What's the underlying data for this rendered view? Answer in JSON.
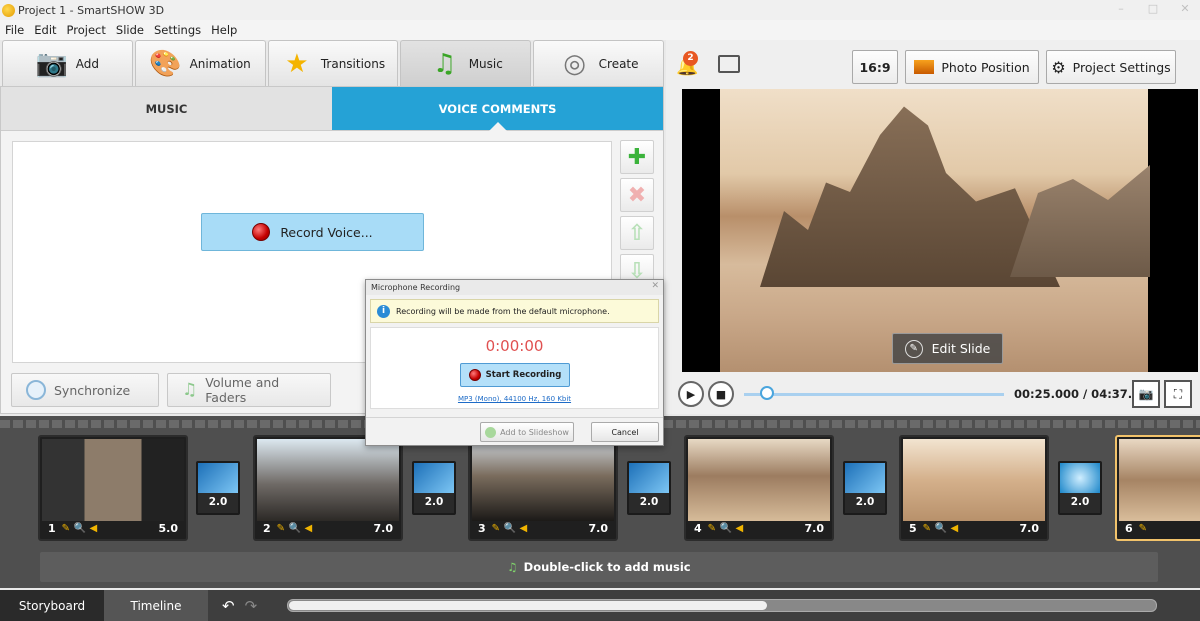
{
  "window": {
    "title": "Project 1 - SmartSHOW 3D"
  },
  "menu": [
    "File",
    "Edit",
    "Project",
    "Slide",
    "Settings",
    "Help"
  ],
  "tabs": [
    {
      "label": "Add",
      "icon": "camera-icon"
    },
    {
      "label": "Animation",
      "icon": "palette-icon"
    },
    {
      "label": "Transitions",
      "icon": "star-icon"
    },
    {
      "label": "Music",
      "icon": "music-note-icon",
      "active": true
    },
    {
      "label": "Create",
      "icon": "film-reel-icon"
    }
  ],
  "subtabs": {
    "music": "MUSIC",
    "voice": "VOICE COMMENTS"
  },
  "voice": {
    "record_label": "Record Voice..."
  },
  "side_buttons": [
    "add-icon",
    "delete-icon",
    "move-up-icon",
    "move-down-icon"
  ],
  "bottom_buttons": {
    "sync": "Synchronize",
    "volume": "Volume and Faders"
  },
  "right_toolbar": {
    "notifications_count": "2",
    "aspect": "16:9",
    "photo_position": "Photo Position",
    "project_settings": "Project Settings"
  },
  "preview": {
    "edit_slide": "Edit Slide",
    "timecode": "00:25.000 / 04:37.000"
  },
  "slides": [
    {
      "num": "1",
      "dur": "5.0"
    },
    {
      "num": "2",
      "dur": "7.0"
    },
    {
      "num": "3",
      "dur": "7.0"
    },
    {
      "num": "4",
      "dur": "7.0"
    },
    {
      "num": "5",
      "dur": "7.0"
    },
    {
      "num": "6",
      "dur": ""
    }
  ],
  "transitions": [
    "2.0",
    "2.0",
    "2.0",
    "2.0",
    "2.0"
  ],
  "music_hint": "Double-click to add music",
  "bottom_tabs": {
    "storyboard": "Storyboard",
    "timeline": "Timeline"
  },
  "dialog": {
    "title": "Microphone Recording",
    "info": "Recording will be made from the default microphone.",
    "time": "0:00:00",
    "start": "Start Recording",
    "format": "MP3 (Mono), 44100 Hz, 160 Kbit",
    "add": "Add to Slideshow",
    "cancel": "Cancel"
  },
  "colors": {
    "accent": "#25a2d6",
    "record": "#c40000",
    "selected_slide": "#f2c36b"
  }
}
